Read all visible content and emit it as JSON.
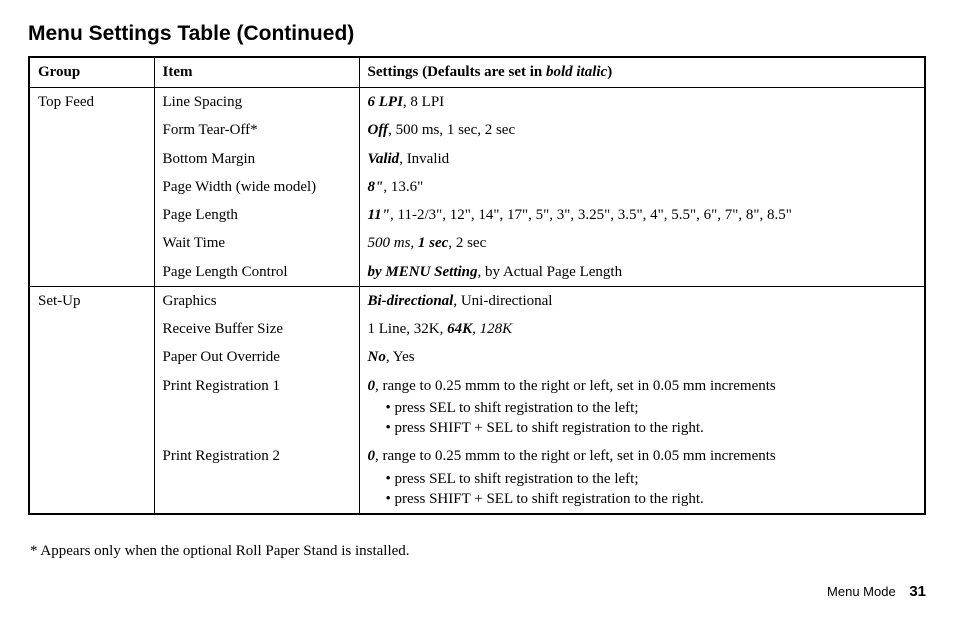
{
  "title": "Menu Settings Table (Continued)",
  "columns": {
    "group": "Group",
    "item": "Item",
    "settings_prefix": "Settings (Defaults are set in ",
    "settings_emph": "bold italic",
    "settings_suffix": ")"
  },
  "groups": [
    {
      "name": "Top Feed",
      "rows": [
        {
          "item": "Line Spacing",
          "settings": [
            {
              "t": "6 LPI",
              "s": "bi"
            },
            {
              "t": ", 8 LPI"
            }
          ]
        },
        {
          "item": "Form Tear-Off*",
          "settings": [
            {
              "t": "Off",
              "s": "bi"
            },
            {
              "t": ", ",
              "s": "ital"
            },
            {
              "t": "500 ms, 1 sec, 2 sec"
            }
          ]
        },
        {
          "item": "Bottom Margin",
          "settings": [
            {
              "t": "Valid",
              "s": "bi"
            },
            {
              "t": ", Invalid"
            }
          ]
        },
        {
          "item": "Page Width (wide model)",
          "settings": [
            {
              "t": "8\"",
              "s": "bi"
            },
            {
              "t": ", 13.6\""
            }
          ]
        },
        {
          "item": "Page Length",
          "settings": [
            {
              "t": "11\"",
              "s": "bi"
            },
            {
              "t": ", ",
              "s": "ital"
            },
            {
              "t": "11-2/3\", 12\", 14\", 17\", 5\", 3\", 3.25\", 3.5\", 4\", 5.5\", 6\", 7\", 8\", 8.5\""
            }
          ]
        },
        {
          "item": "Wait Time",
          "settings": [
            {
              "t": "500 ms, ",
              "s": "ital"
            },
            {
              "t": "1 sec",
              "s": "bi"
            },
            {
              "t": ", 2 sec"
            }
          ]
        },
        {
          "item": "Page Length Control",
          "settings": [
            {
              "t": "by MENU Setting",
              "s": "bi"
            },
            {
              "t": ", by Actual Page Length"
            }
          ]
        }
      ]
    },
    {
      "name": "Set-Up",
      "rows": [
        {
          "item": "Graphics",
          "settings": [
            {
              "t": "Bi-directional",
              "s": "bi"
            },
            {
              "t": ", Uni-directional"
            }
          ]
        },
        {
          "item": "Receive Buffer Size",
          "settings": [
            {
              "t": "1 Line, 32K, "
            },
            {
              "t": "64K",
              "s": "bi"
            },
            {
              "t": ", ",
              "s": "ital"
            },
            {
              "t": "128K",
              "s": "ital"
            }
          ]
        },
        {
          "item": "Paper Out Override",
          "settings": [
            {
              "t": "No",
              "s": "bi"
            },
            {
              "t": ", Yes"
            }
          ]
        },
        {
          "item": "Print Registration 1",
          "settings": [
            {
              "t": "0",
              "s": "bi"
            },
            {
              "t": ", range to 0.25 mmm to the right or left, set in 0.05 mm increments"
            }
          ],
          "bullets": [
            "press SEL to shift registration to the left;",
            "press SHIFT + SEL to shift registration to the right."
          ]
        },
        {
          "item": "Print Registration 2",
          "settings": [
            {
              "t": "0",
              "s": "bi"
            },
            {
              "t": ", range to 0.25 mmm to the right or left, set in 0.05 mm increments"
            }
          ],
          "bullets": [
            "press SEL to shift registration to the left;",
            "press SHIFT + SEL to shift registration to the right."
          ]
        }
      ]
    }
  ],
  "footnote": "* Appears only when the optional Roll Paper Stand is installed.",
  "footer": {
    "section": "Menu Mode",
    "page": "31"
  }
}
